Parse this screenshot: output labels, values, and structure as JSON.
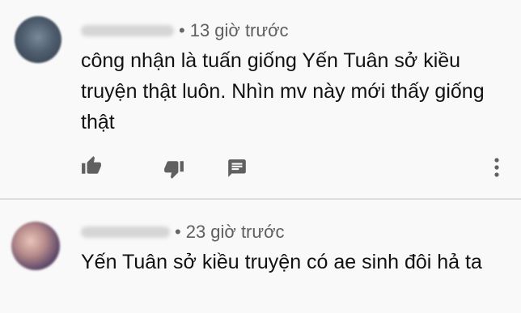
{
  "comments": [
    {
      "author": "",
      "separator": "•",
      "time": "13 giờ trước",
      "text": "công nhận là tuấn giống Yến Tuân sở kiều truyện thật luôn. Nhìn mv này mới thấy giống thật",
      "actions": {
        "like_icon": "thumb-up-icon",
        "dislike_icon": "thumb-down-icon",
        "reply_icon": "reply-icon",
        "more_icon": "more-vert-icon"
      }
    },
    {
      "author": "",
      "separator": "•",
      "time": "23 giờ trước",
      "text": "Yến Tuân sở kiều truyện có ae sinh đôi hả ta"
    }
  ],
  "colors": {
    "background": "#f9f9f9",
    "text": "#111111",
    "meta": "#5f5f5f",
    "icon": "#606060",
    "divider": "#dedede"
  }
}
